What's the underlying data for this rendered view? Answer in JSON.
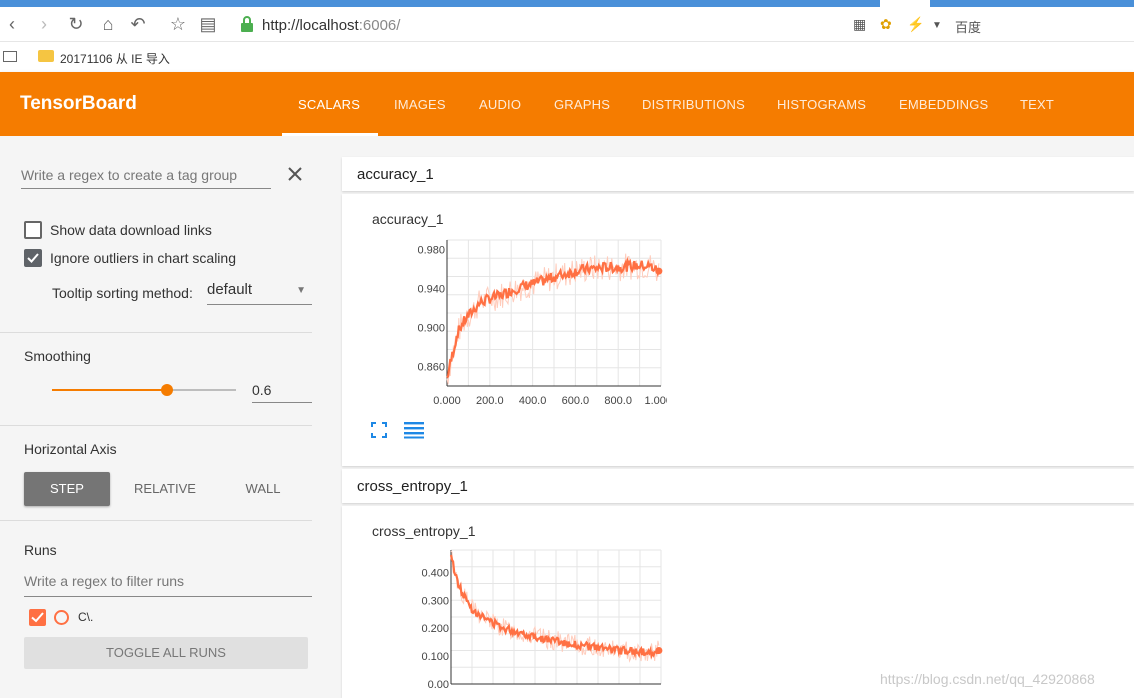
{
  "browser": {
    "url_host": "http://localhost",
    "url_rest": ":6006/",
    "search_engine": "百度",
    "bookmark_label": "20171106 从 IE 导入"
  },
  "header": {
    "title": "TensorBoard",
    "tabs": [
      "SCALARS",
      "IMAGES",
      "AUDIO",
      "GRAPHS",
      "DISTRIBUTIONS",
      "HISTOGRAMS",
      "EMBEDDINGS",
      "TEXT"
    ],
    "active_tab": "SCALARS",
    "accent_color": "#f57c00"
  },
  "sidebar": {
    "tag_regex_placeholder": "Write a regex to create a tag group",
    "show_download_label": "Show data download links",
    "show_download_checked": false,
    "ignore_outliers_label": "Ignore outliers in chart scaling",
    "ignore_outliers_checked": true,
    "tooltip_label": "Tooltip sorting method:",
    "tooltip_value": "default",
    "smoothing_title": "Smoothing",
    "smoothing_value": "0.6",
    "smoothing_fraction": 0.6,
    "axis_title": "Horizontal Axis",
    "axis_options": [
      "STEP",
      "RELATIVE",
      "WALL"
    ],
    "axis_selected": "STEP",
    "runs_title": "Runs",
    "runs_filter_placeholder": "Write a regex to filter runs",
    "run_name": "C\\.",
    "toggle_runs_label": "TOGGLE ALL RUNS"
  },
  "main": {
    "cards": [
      {
        "header": "accuracy_1",
        "chart_title": "accuracy_1"
      },
      {
        "header": "cross_entropy_1",
        "chart_title": "cross_entropy_1"
      }
    ]
  },
  "chart_data": [
    {
      "type": "line",
      "title": "accuracy_1",
      "x_ticks": [
        "0.000",
        "200.0",
        "400.0",
        "600.0",
        "800.0",
        "1.000k"
      ],
      "y_ticks": [
        "0.980",
        "0.940",
        "0.900",
        "0.860"
      ],
      "xlim": [
        0,
        1000
      ],
      "ylim": [
        0.84,
        0.99
      ],
      "series": [
        {
          "color": "#ff7043",
          "x": [
            0,
            25,
            50,
            75,
            100,
            150,
            200,
            250,
            300,
            350,
            400,
            450,
            500,
            550,
            600,
            650,
            700,
            750,
            800,
            850,
            900,
            950,
            990
          ],
          "y": [
            0.848,
            0.872,
            0.895,
            0.905,
            0.912,
            0.925,
            0.93,
            0.933,
            0.938,
            0.942,
            0.945,
            0.948,
            0.952,
            0.955,
            0.958,
            0.96,
            0.961,
            0.962,
            0.962,
            0.963,
            0.964,
            0.963,
            0.958
          ]
        }
      ]
    },
    {
      "type": "line",
      "title": "cross_entropy_1",
      "x_ticks": [],
      "y_ticks": [
        "0.400",
        "0.300",
        "0.200",
        "0.100",
        "0.00"
      ],
      "ylim": [
        0,
        0.48
      ],
      "series": [
        {
          "color": "#ff7043",
          "x": [
            0,
            25,
            50,
            75,
            100,
            150,
            200,
            250,
            300,
            350,
            400,
            450,
            500,
            550,
            600,
            650,
            700,
            750,
            800,
            850,
            900,
            950,
            990
          ],
          "y": [
            0.46,
            0.38,
            0.33,
            0.3,
            0.27,
            0.24,
            0.22,
            0.2,
            0.19,
            0.18,
            0.17,
            0.16,
            0.155,
            0.145,
            0.14,
            0.135,
            0.13,
            0.125,
            0.12,
            0.118,
            0.115,
            0.112,
            0.12
          ]
        }
      ]
    }
  ],
  "watermark": "https://blog.csdn.net/qq_42920868"
}
